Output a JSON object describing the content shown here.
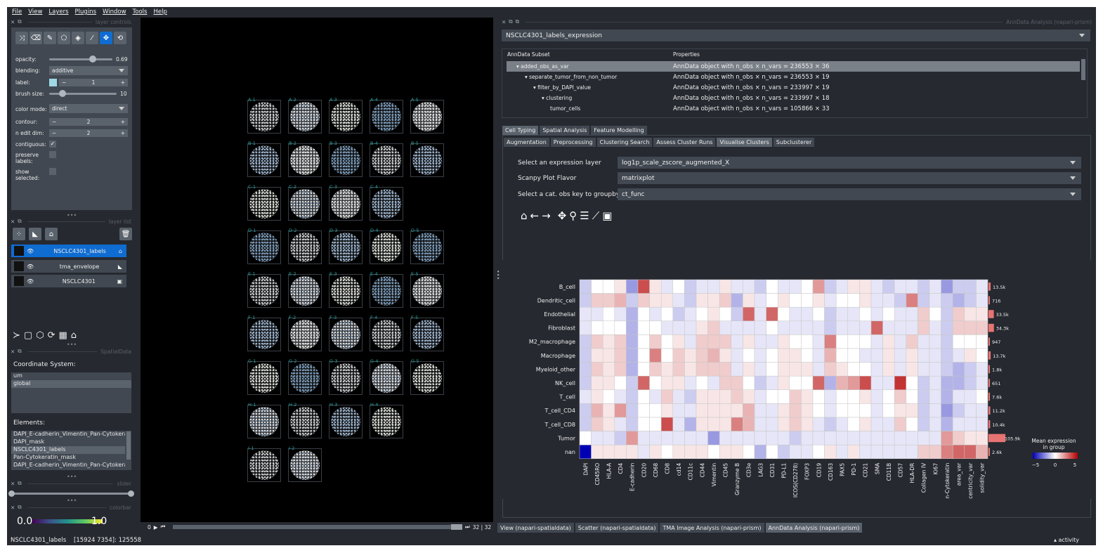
{
  "menu": [
    "File",
    "View",
    "Layers",
    "Plugins",
    "Window",
    "Tools",
    "Help"
  ],
  "layer_controls": {
    "title": "layer controls",
    "opacity_label": "opacity:",
    "opacity_value": "0.69",
    "opacity_fraction": 0.69,
    "blending_label": "blending:",
    "blending_value": "additive",
    "label_label": "label:",
    "label_value": "1",
    "brush_label": "brush size:",
    "brush_value": "10",
    "brush_fraction": 0.2,
    "color_mode_label": "color mode:",
    "color_mode_value": "direct",
    "contour_label": "contour:",
    "contour_value": "2",
    "n_edit_label": "n edit dim:",
    "n_edit_value": "2",
    "contiguous_label": "contiguous:",
    "preserve_label": "preserve labels:",
    "show_selected_label": "show selected:"
  },
  "layer_list": {
    "title": "layer list",
    "layers": [
      {
        "name": "NSCLC4301_labels",
        "selected": true
      },
      {
        "name": "tma_envelope",
        "selected": false
      },
      {
        "name": "NSCLC4301",
        "selected": false
      }
    ]
  },
  "spatialdata": {
    "title": "SpatialData",
    "coord_label": "Coordinate System:",
    "coords": [
      "um",
      "global"
    ],
    "elements_label": "Elements:",
    "elements": [
      "DAPI_E-cadherin_Vimentin_Pan-Cytokerati",
      "DAPI_mask",
      "NSCLC4301_labels",
      "Pan-Cytokeratin_mask",
      "DAPI_E-cadherin_Vimentin_Pan-Cytokerati"
    ]
  },
  "slider_title": "slider",
  "colorbar": {
    "title": "colorbar",
    "min": "0.0",
    "max": "1.0"
  },
  "cores": {
    "rows": [
      [
        "A-1",
        "A-2",
        "A-3",
        "A-4",
        "A-5"
      ],
      [
        "B-1",
        "B-2",
        "B-3",
        "B-4",
        "B-5"
      ],
      [
        "C-1",
        "C-2",
        "C-3",
        "C-4",
        ""
      ],
      [
        "D-1",
        "D-2",
        "D-3",
        "D-4",
        "D-5"
      ],
      [
        "E-1",
        "E-2",
        "E-3",
        "E-4",
        "E-5"
      ],
      [
        "F-1",
        "F-2",
        "F-3",
        "F-4",
        "F-5"
      ],
      [
        "G-1",
        "G-2",
        "G-3",
        "G-4",
        "G-5"
      ],
      [
        "H-1",
        "H-2",
        "H-3",
        "H-4",
        ""
      ],
      [
        "I-1",
        "I-2",
        "",
        "",
        ""
      ]
    ]
  },
  "canvas_footer": {
    "frame": "0",
    "counter": "32 | 32"
  },
  "anndata": {
    "title": "AnnData Analysis (napari-prism)",
    "selected": "NSCLC4301_labels_expression",
    "col_subset": "AnnData Subset",
    "col_props": "Properties",
    "tree": [
      {
        "name": "added_obs_as_var",
        "props": "AnnData object with n_obs × n_vars = 236553 × 36",
        "indent": 0,
        "selected": true
      },
      {
        "name": "separate_tumor_from_non_tumor",
        "props": "AnnData object with n_obs × n_vars = 236553 × 19",
        "indent": 1,
        "selected": false
      },
      {
        "name": "filter_by_DAPI_value",
        "props": "AnnData object with n_obs × n_vars = 233997 × 19",
        "indent": 2,
        "selected": false
      },
      {
        "name": "clustering",
        "props": "AnnData object with n_obs × n_vars = 233997 × 18",
        "indent": 3,
        "selected": false
      },
      {
        "name": "tumor_cells",
        "props": "AnnData object with n_obs × n_vars = 105866 × 33",
        "indent": 4,
        "selected": false
      }
    ],
    "tabs1": [
      "Cell Typing",
      "Spatial Analysis",
      "Feature Modelling"
    ],
    "tabs2": [
      "Augmentation",
      "Preprocessing",
      "Clustering Search",
      "Assess Cluster Runs",
      "Visualise Clusters",
      "Subclusterer"
    ],
    "expr_label": "Select an expression layer",
    "expr_value": "log1p_scale_zscore_augmented_X",
    "flavor_label": "Scanpy Plot Flavor",
    "flavor_value": "matrixplot",
    "groupby_label": "Select a cat. obs key to groupby",
    "groupby_value": "ct_func"
  },
  "bottom_tabs": [
    "View (napari-spatialdata)",
    "Scatter (napari-spatialdata)",
    "TMA Image Analysis (napari-prism)",
    "AnnData Analysis (napari-prism)"
  ],
  "status_text": "NSCLC4301_labels    [15924 7354]: 125558",
  "activity": "▴ activity",
  "chart_data": {
    "type": "heatmap",
    "rows": [
      "B_cell",
      "Dendritic_cell",
      "Endothelial",
      "Fibroblast",
      "M2_macrophage",
      "Macrophage",
      "Myeloid_other",
      "NK_cell",
      "T_cell",
      "T_cell_CD4",
      "T_cell_CD8",
      "Tumor",
      "nan"
    ],
    "cols": [
      "DAPI",
      "CD45RO",
      "HLA-A",
      "CD4",
      "E-cadherin",
      "CD20",
      "CD68",
      "CD8",
      "cd14",
      "CD11c",
      "CD44",
      "Vimentin",
      "CD45",
      "Granzyme B",
      "CD3e",
      "LAG3",
      "CD31",
      "PD-L1",
      "ICOS(CD278)",
      "FOXP3",
      "CD19",
      "CD163",
      "PAX5",
      "PD-1",
      "CD21",
      "SMA",
      "CD11B",
      "CD57",
      "HLA-DR",
      "Collagen IV",
      "Ki67",
      "Pan-Cytokeratin",
      "area_var",
      "eccentricity_var",
      "solidity_var"
    ],
    "counts": [
      "13.5k",
      "716",
      "33.5k",
      "34.3k",
      "947",
      "13.7k",
      "1.8k",
      "651",
      "7.6k",
      "11.2k",
      "10.4k",
      "105.9k",
      "2.6k"
    ],
    "count_values": [
      13500,
      716,
      33500,
      34300,
      947,
      13700,
      1800,
      651,
      7600,
      11200,
      10400,
      105900,
      2600
    ],
    "values": [
      [
        -1,
        0,
        0,
        0.5,
        -2,
        3.5,
        0.5,
        -0.5,
        0,
        -1,
        -0.5,
        -0.5,
        0.5,
        -0.5,
        -0.5,
        -1,
        0,
        -0.5,
        -0.5,
        0,
        2,
        -1,
        -0.5,
        0.5,
        0.5,
        -0.5,
        -1,
        -0.5,
        -0.5,
        -1,
        -0.5,
        -2,
        -1,
        -1,
        -0.5
      ],
      [
        -1,
        1,
        1,
        1.5,
        -1,
        1,
        0.5,
        0.5,
        -0.5,
        -1,
        0.5,
        0.5,
        1,
        -1.5,
        0.5,
        -0.5,
        0,
        0.5,
        0,
        0,
        0.5,
        -0.5,
        0,
        0,
        0.5,
        -0.5,
        -0.5,
        -1,
        2.5,
        -1,
        -0.5,
        -1,
        -1.5,
        -1,
        -0.5
      ],
      [
        -0.5,
        -0.5,
        0,
        -0.5,
        -1.5,
        0,
        -0.5,
        0,
        -1,
        -0.5,
        0,
        0.5,
        0,
        -1,
        3,
        -0.5,
        3,
        0,
        -0.5,
        -0.5,
        0,
        -1,
        -0.5,
        -0.5,
        0,
        -0.5,
        0,
        -0.5,
        -0.5,
        1,
        0,
        -1,
        1,
        0.5,
        0.5
      ],
      [
        -0.5,
        0,
        0,
        0,
        -1.5,
        0,
        0,
        -0.5,
        -0.5,
        -0.5,
        0.5,
        1,
        -0.5,
        -0.5,
        -0.5,
        -0.5,
        0,
        -0.5,
        -0.5,
        -0.5,
        -0.5,
        -1,
        -0.5,
        -0.5,
        -0.5,
        3,
        -0.5,
        -0.5,
        -0.5,
        1,
        -0.5,
        -1,
        1,
        1,
        1
      ],
      [
        -1,
        1,
        0.5,
        1,
        -1.5,
        0,
        1,
        0,
        0.5,
        -0.5,
        1,
        1,
        1,
        -0.5,
        0.5,
        -0.5,
        -0.5,
        0.5,
        0,
        0,
        -0.5,
        2.5,
        0,
        0,
        0,
        -0.5,
        0.5,
        -0.5,
        1,
        -0.5,
        -0.5,
        -1,
        0,
        0,
        0
      ],
      [
        -1,
        0.5,
        0.5,
        1,
        -1.5,
        0,
        2.5,
        0,
        1,
        0.5,
        1,
        1.5,
        0.5,
        -0.5,
        0,
        -0.5,
        0,
        0.5,
        0.5,
        0,
        -0.5,
        1.5,
        0,
        0,
        -0.5,
        -0.5,
        0.5,
        -0.5,
        0.5,
        -0.5,
        -0.5,
        -1,
        -0.5,
        0.5,
        0
      ],
      [
        -1,
        1,
        0.5,
        1,
        -1.5,
        0,
        1,
        0.5,
        1,
        0.5,
        1,
        1,
        1,
        -0.5,
        0.5,
        -0.5,
        0,
        0.5,
        0.5,
        0.5,
        -0.5,
        1,
        0.5,
        0,
        0,
        -0.5,
        0.5,
        -0.5,
        0.5,
        -0.5,
        -0.5,
        -1,
        -1.5,
        -1,
        -0.5
      ],
      [
        -1,
        0.5,
        0.5,
        0,
        -1,
        3,
        0,
        0.5,
        0.5,
        -0.5,
        0,
        -0.5,
        1,
        1,
        0,
        -1,
        -0.5,
        0.5,
        0,
        0,
        3,
        -1.5,
        1.5,
        2,
        3.5,
        -0.5,
        -0.5,
        4,
        0,
        -1,
        -0.5,
        -1.5,
        -1.5,
        -1,
        -0.5
      ],
      [
        -0.5,
        0.5,
        0,
        -0.5,
        -1,
        0,
        -0.5,
        1,
        -0.5,
        -1,
        0.5,
        0.5,
        0.5,
        1,
        0.5,
        -0.5,
        0,
        0,
        1,
        0.5,
        0,
        -0.5,
        0,
        0,
        0.5,
        -0.5,
        0,
        1,
        0,
        -1,
        -0.5,
        -1.5,
        -0.5,
        -0.5,
        0
      ],
      [
        -1,
        1.5,
        0.5,
        2,
        -1,
        0,
        0,
        0.5,
        -0.5,
        -0.5,
        0.5,
        0.5,
        0.5,
        0.5,
        1.5,
        -0.5,
        -0.5,
        0.5,
        1,
        0.5,
        0,
        -0.5,
        0,
        0,
        0,
        -0.5,
        0,
        0.5,
        0.5,
        -1,
        -0.5,
        -2,
        -1,
        -0.5,
        -0.5
      ],
      [
        -1,
        1,
        0.5,
        -0.5,
        -1,
        0,
        0,
        3.5,
        -0.5,
        -1.5,
        0.5,
        0.5,
        0.5,
        2.5,
        1.5,
        -0.5,
        -0.5,
        0.5,
        1,
        0.5,
        -0.5,
        -1,
        -0.5,
        0,
        0.5,
        -0.5,
        -0.5,
        1,
        0,
        -1,
        -0.5,
        -1.5,
        -0.5,
        -0.5,
        -0.5
      ],
      [
        0,
        -0.5,
        -0.5,
        -1,
        2,
        -0.5,
        -0.5,
        -0.5,
        -0.5,
        -0.5,
        -0.5,
        -2,
        -0.5,
        -0.5,
        -0.5,
        -0.5,
        -0.5,
        -0.5,
        -1,
        -0.5,
        -0.5,
        -0.5,
        -0.5,
        -0.5,
        -0.5,
        -0.5,
        -0.5,
        -0.5,
        -0.5,
        -0.5,
        -0.5,
        2,
        1,
        0.5,
        0.5
      ],
      [
        -5,
        0.5,
        0.5,
        0.5,
        0.5,
        -0.5,
        0.5,
        0,
        0.5,
        0.5,
        0.5,
        0,
        0.5,
        0.5,
        0,
        -1.5,
        0,
        -1,
        -0.5,
        -0.5,
        0,
        0.5,
        -0.5,
        0.5,
        -0.5,
        -0.5,
        -0.5,
        -0.5,
        -0.5,
        1,
        1,
        2.5,
        3,
        3,
        1.5
      ]
    ],
    "colorbar_title": "Mean expression\nin group",
    "colorbar_ticks": [
      "−5",
      "0",
      "5"
    ],
    "vmin": -5,
    "vmax": 5
  }
}
